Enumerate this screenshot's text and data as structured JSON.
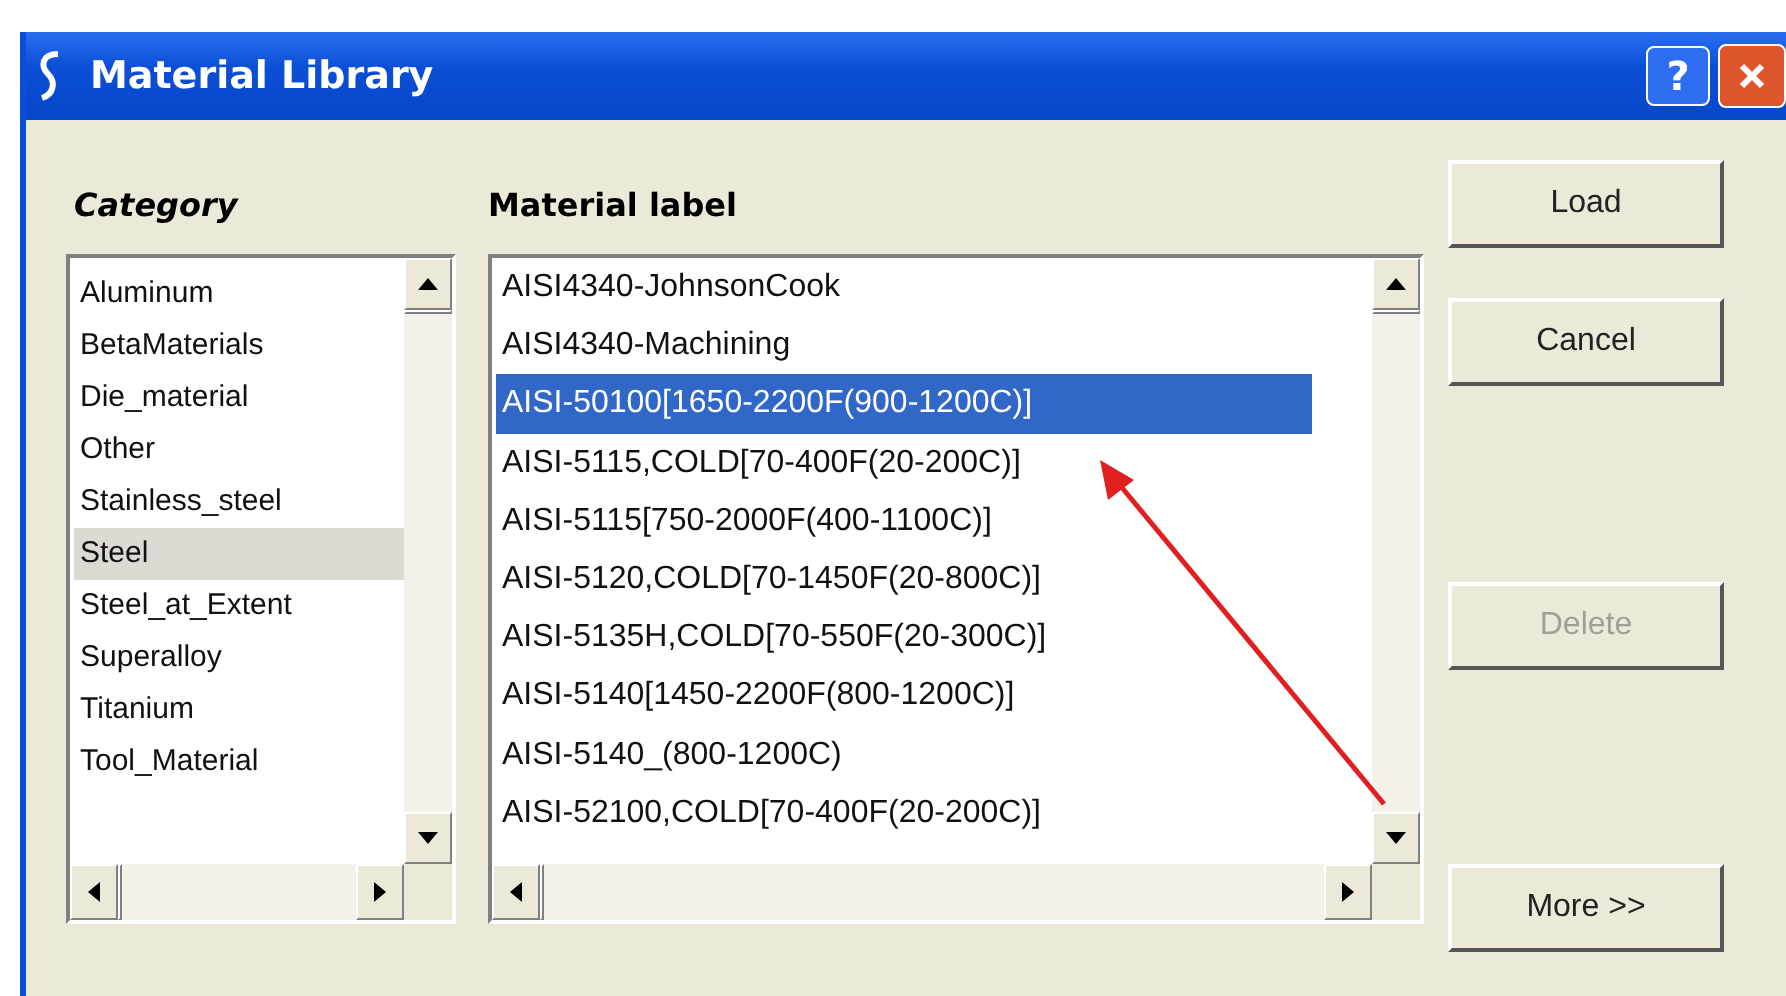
{
  "window": {
    "title": "Material Library",
    "help": "?"
  },
  "category": {
    "heading": "Category",
    "items": [
      {
        "label": "Aluminum",
        "selected": false
      },
      {
        "label": "BetaMaterials",
        "selected": false
      },
      {
        "label": "Die_material",
        "selected": false
      },
      {
        "label": "Other",
        "selected": false
      },
      {
        "label": "Stainless_steel",
        "selected": false
      },
      {
        "label": "Steel",
        "selected": true
      },
      {
        "label": "Steel_at_Extent",
        "selected": false
      },
      {
        "label": "Superalloy",
        "selected": false
      },
      {
        "label": "Titanium",
        "selected": false
      },
      {
        "label": "Tool_Material",
        "selected": false
      }
    ]
  },
  "material": {
    "heading": "Material label",
    "items": [
      {
        "label": "AISI4340-JohnsonCook",
        "selected": false
      },
      {
        "label": "AISI4340-Machining",
        "selected": false
      },
      {
        "label": "AISI-50100[1650-2200F(900-1200C)]",
        "selected": true
      },
      {
        "label": "AISI-5115,COLD[70-400F(20-200C)]",
        "selected": false
      },
      {
        "label": "AISI-5115[750-2000F(400-1100C)]",
        "selected": false
      },
      {
        "label": "AISI-5120,COLD[70-1450F(20-800C)]",
        "selected": false
      },
      {
        "label": "AISI-5135H,COLD[70-550F(20-300C)]",
        "selected": false
      },
      {
        "label": "AISI-5140[1450-2200F(800-1200C)]",
        "selected": false
      },
      {
        "label": "AISI-5140_(800-1200C)",
        "selected": false
      },
      {
        "label": "AISI-52100,COLD[70-400F(20-200C)]",
        "selected": false
      }
    ]
  },
  "buttons": [
    {
      "label": "Load",
      "disabled": false
    },
    {
      "label": "Cancel",
      "disabled": false
    },
    {
      "label": "Delete",
      "disabled": true
    },
    {
      "label": "More >>",
      "disabled": false
    }
  ]
}
